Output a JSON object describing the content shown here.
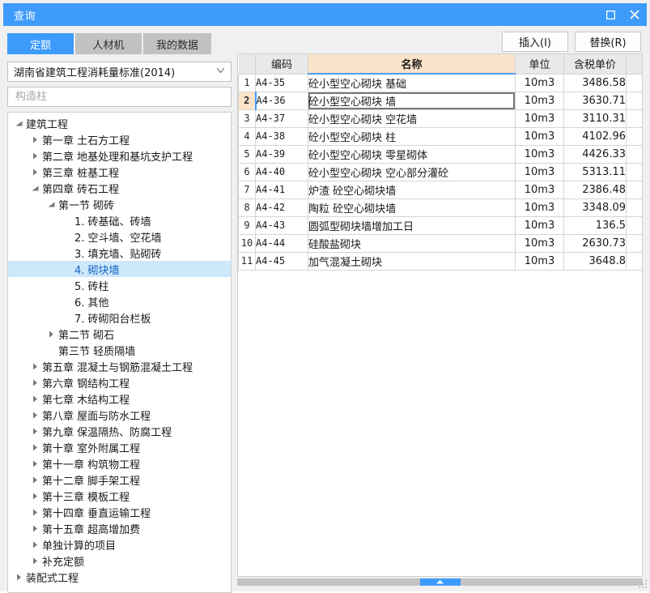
{
  "window": {
    "title": "查询",
    "maximize_icon": "maximize-icon",
    "close_icon": "close-icon"
  },
  "tabs": [
    {
      "label": "定额",
      "active": true
    },
    {
      "label": "人材机",
      "active": false
    },
    {
      "label": "我的数据",
      "active": false
    }
  ],
  "toolbar": {
    "insert_label": "插入(I)",
    "replace_label": "替换(R)"
  },
  "left_panel": {
    "standard_select": {
      "value": "湖南省建筑工程消耗量标准(2014)",
      "caret_icon": "chevron-down-icon"
    },
    "search": {
      "value": "",
      "placeholder": "构造柱"
    },
    "tree": [
      {
        "label": "建筑工程",
        "indent": 0,
        "state": "expanded",
        "selected": false
      },
      {
        "label": "第一章 土石方工程",
        "indent": 1,
        "state": "collapsed",
        "selected": false
      },
      {
        "label": "第二章 地基处理和基坑支护工程",
        "indent": 1,
        "state": "collapsed",
        "selected": false
      },
      {
        "label": "第三章 桩基工程",
        "indent": 1,
        "state": "collapsed",
        "selected": false
      },
      {
        "label": "第四章 砖石工程",
        "indent": 1,
        "state": "expanded",
        "selected": false
      },
      {
        "label": "第一节 砌砖",
        "indent": 2,
        "state": "expanded",
        "selected": false
      },
      {
        "label": "1. 砖基础、砖墙",
        "indent": 3,
        "state": "leaf",
        "selected": false
      },
      {
        "label": "2. 空斗墙、空花墙",
        "indent": 3,
        "state": "leaf",
        "selected": false
      },
      {
        "label": "3. 填充墙、贴砌砖",
        "indent": 3,
        "state": "leaf",
        "selected": false
      },
      {
        "label": "4. 砌块墙",
        "indent": 3,
        "state": "leaf",
        "selected": true
      },
      {
        "label": "5. 砖柱",
        "indent": 3,
        "state": "leaf",
        "selected": false
      },
      {
        "label": "6. 其他",
        "indent": 3,
        "state": "leaf",
        "selected": false
      },
      {
        "label": "7. 砖砌阳台栏板",
        "indent": 3,
        "state": "leaf",
        "selected": false
      },
      {
        "label": "第二节 砌石",
        "indent": 2,
        "state": "collapsed",
        "selected": false
      },
      {
        "label": "第三节 轻质隔墙",
        "indent": 2,
        "state": "leaf",
        "selected": false
      },
      {
        "label": "第五章 混凝土与钢筋混凝土工程",
        "indent": 1,
        "state": "collapsed",
        "selected": false
      },
      {
        "label": "第六章 钢结构工程",
        "indent": 1,
        "state": "collapsed",
        "selected": false
      },
      {
        "label": "第七章 木结构工程",
        "indent": 1,
        "state": "collapsed",
        "selected": false
      },
      {
        "label": "第八章 屋面与防水工程",
        "indent": 1,
        "state": "collapsed",
        "selected": false
      },
      {
        "label": "第九章 保温隔热、防腐工程",
        "indent": 1,
        "state": "collapsed",
        "selected": false
      },
      {
        "label": "第十章 室外附属工程",
        "indent": 1,
        "state": "collapsed",
        "selected": false
      },
      {
        "label": "第十一章 构筑物工程",
        "indent": 1,
        "state": "collapsed",
        "selected": false
      },
      {
        "label": "第十二章 脚手架工程",
        "indent": 1,
        "state": "collapsed",
        "selected": false
      },
      {
        "label": "第十三章 模板工程",
        "indent": 1,
        "state": "collapsed",
        "selected": false
      },
      {
        "label": "第十四章 垂直运输工程",
        "indent": 1,
        "state": "collapsed",
        "selected": false
      },
      {
        "label": "第十五章 超高增加费",
        "indent": 1,
        "state": "collapsed",
        "selected": false
      },
      {
        "label": "单独计算的项目",
        "indent": 1,
        "state": "collapsed",
        "selected": false
      },
      {
        "label": "补充定额",
        "indent": 1,
        "state": "collapsed",
        "selected": false
      },
      {
        "label": "装配式工程",
        "indent": 0,
        "state": "collapsed",
        "selected": false
      }
    ]
  },
  "grid": {
    "columns": [
      "",
      "编码",
      "名称",
      "单位",
      "含税单价",
      ""
    ],
    "selected_row_index": 2,
    "rows": [
      {
        "idx": "1",
        "code": "A4-35",
        "name": "砼小型空心砌块 基础",
        "unit": "10m3",
        "price": "3486.58"
      },
      {
        "idx": "2",
        "code": "A4-36",
        "name": "砼小型空心砌块 墙",
        "unit": "10m3",
        "price": "3630.71"
      },
      {
        "idx": "3",
        "code": "A4-37",
        "name": "砼小型空心砌块 空花墙",
        "unit": "10m3",
        "price": "3110.31"
      },
      {
        "idx": "4",
        "code": "A4-38",
        "name": "砼小型空心砌块 柱",
        "unit": "10m3",
        "price": "4102.96"
      },
      {
        "idx": "5",
        "code": "A4-39",
        "name": "砼小型空心砌块 零星砌体",
        "unit": "10m3",
        "price": "4426.33"
      },
      {
        "idx": "6",
        "code": "A4-40",
        "name": "砼小型空心砌块 空心部分灌砼",
        "unit": "10m3",
        "price": "5313.11"
      },
      {
        "idx": "7",
        "code": "A4-41",
        "name": "炉渣 砼空心砌块墙",
        "unit": "10m3",
        "price": "2386.48"
      },
      {
        "idx": "8",
        "code": "A4-42",
        "name": "陶粒 砼空心砌块墙",
        "unit": "10m3",
        "price": "3348.09"
      },
      {
        "idx": "9",
        "code": "A4-43",
        "name": "圆弧型砌块墙增加工日",
        "unit": "10m3",
        "price": "136.5"
      },
      {
        "idx": "10",
        "code": "A4-44",
        "name": "硅酸盐砌块",
        "unit": "10m3",
        "price": "2630.73"
      },
      {
        "idx": "11",
        "code": "A4-45",
        "name": "加气混凝土砌块",
        "unit": "10m3",
        "price": "3648.8"
      }
    ]
  },
  "splitter": {
    "handle_icon": "collapse-up-icon"
  },
  "colors": {
    "accent": "#3d9bfb",
    "name_header_bg": "#fae3ca",
    "selection_bg": "#cde8fb",
    "header_bg": "#e9e9e9"
  }
}
